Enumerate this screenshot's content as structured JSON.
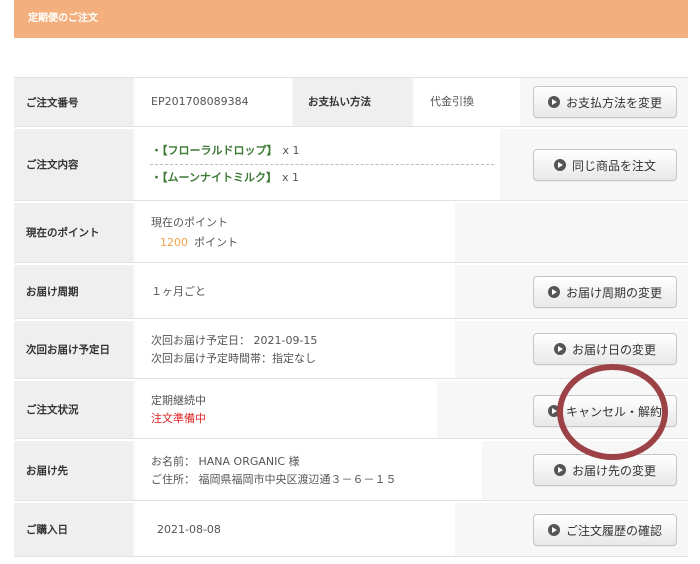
{
  "header": {
    "title": "定期便のご注文"
  },
  "order_number": {
    "label": "ご注文番号",
    "value": "EP201708089384",
    "payment_label": "お支払い方法",
    "payment_value": "代金引換",
    "button": "お支払方法を変更"
  },
  "order_contents": {
    "label": "ご注文内容",
    "items": [
      {
        "bullet": "・",
        "name": "【フローラルドロップ】",
        "qty": "x 1"
      },
      {
        "bullet": "・",
        "name": "【ムーンナイトミルク】",
        "qty": "x 1"
      }
    ],
    "button": "同じ商品を注文"
  },
  "points": {
    "label": "現在のポイント",
    "caption": "現在のポイント",
    "value": "1200",
    "unit": "ポイント"
  },
  "delivery_cycle": {
    "label": "お届け周期",
    "value": "１ヶ月ごと",
    "button": "お届け周期の変更"
  },
  "next_delivery": {
    "label": "次回お届け予定日",
    "date_line": "次回お届け予定日： 2021-09-15",
    "time_line": "次回お届け予定時間帯：指定なし",
    "button": "お届け日の変更"
  },
  "order_status": {
    "label": "ご注文状況",
    "subscription_status": "定期継続中",
    "order_state": "注文準備中",
    "button": "キャンセル・解約"
  },
  "shipping": {
    "label": "お届け先",
    "name_line": "お名前： HANA ORGANIC 様",
    "address_line": "ご住所： 福岡県福岡市中央区渡辺通３－６－１５",
    "button": "お届け先の変更"
  },
  "purchase_date": {
    "label": "ご購入日",
    "value": "2021-08-08",
    "button": "ご注文履歴の確認"
  },
  "icons": {
    "button_icon": "play-circle-icon"
  },
  "colors": {
    "header": "#f3b07e",
    "points_value": "#f0a04b",
    "order_state": "#e02424",
    "item_name": "#3d7a35",
    "highlight_circle": "#9c4246"
  }
}
